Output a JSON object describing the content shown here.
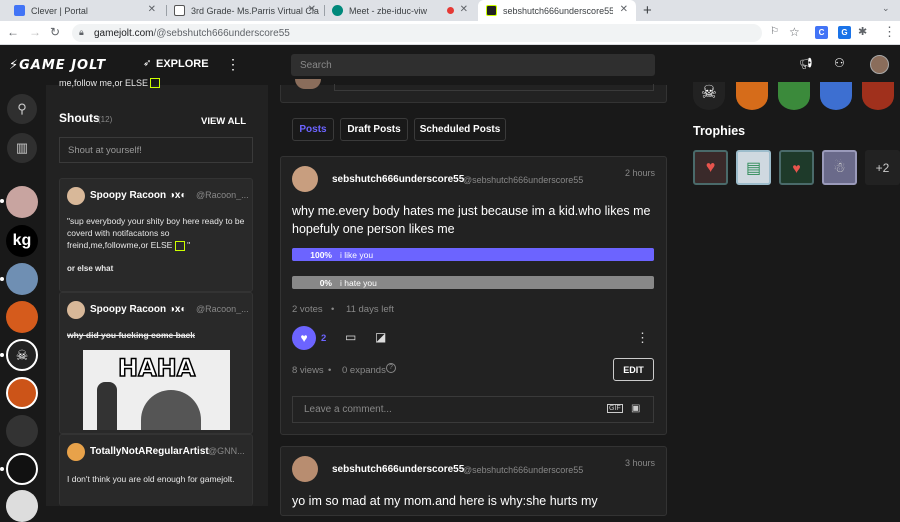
{
  "browser": {
    "tabs": [
      {
        "title": "Clever | Portal",
        "active": false
      },
      {
        "title": "3rd Grade- Ms.Parris Virtual Cla",
        "active": false
      },
      {
        "title": "Meet - zbe-iduc-viw",
        "active": false
      },
      {
        "title": "sebshutch666underscore55 (@s",
        "active": true
      }
    ],
    "new_tab": "+",
    "url_host": "gamejolt.com",
    "url_path": "/@sebshutch666underscore55"
  },
  "site": {
    "logo": "GAME JOLT",
    "explore": "EXPLORE",
    "search_placeholder": "Search"
  },
  "shouts": {
    "top_snippet": "me,follow me,or ELSE",
    "title": "Shouts",
    "count": "(12)",
    "view_all": "VIEW ALL",
    "input_placeholder": "Shout at yourself!",
    "items": [
      {
        "name": "Spoopy Racoon ◑x◐",
        "handle": "@Racoon_...",
        "text": "\"sup everybody your shity boy here ready to be coverd with notifacatons so freind,me,followme,or ELSE",
        "text_end": "\"",
        "extra": "or else what"
      },
      {
        "name": "Spoopy Racoon ◑x◐",
        "handle": "@Racoon_...",
        "text": "why did you fucking come back",
        "image_text": "HAHA"
      },
      {
        "name": "TotallyNotARegularArtist",
        "handle": "@GNN...",
        "text": "I don't think you are old enough for gamejolt."
      }
    ]
  },
  "feed": {
    "tabs": [
      "Posts",
      "Draft Posts",
      "Scheduled Posts"
    ],
    "post1": {
      "author": "sebshutch666underscore55",
      "handle": "@sebshutch666underscore55",
      "time": "2 hours",
      "text": "why me.every body hates me just because im a kid.who likes me hopefuly one person likes me",
      "poll": [
        {
          "percent": "100%",
          "label": "i like you",
          "fraction": 1.0
        },
        {
          "percent": "0%",
          "label": "i hate you",
          "fraction": 0.0
        }
      ],
      "votes": "2 votes",
      "time_left": "11 days left",
      "likes": "2",
      "views": "8 views",
      "expands": "0 expands",
      "edit": "EDIT",
      "comment_placeholder": "Leave a comment...",
      "gif": "GIF"
    },
    "post2": {
      "author": "sebshutch666underscore55",
      "handle": "@sebshutch666underscore55",
      "time": "3 hours",
      "text": "yo im so mad at my mom.and here is why:she hurts my"
    }
  },
  "right": {
    "trophies_title": "Trophies",
    "trophies_more": "+2"
  },
  "colors": {
    "accent": "#6c64ff",
    "poll_bar_full": "#6c64ff",
    "poll_bar_empty": "#888888",
    "shout_highlight": "#ccff00"
  }
}
